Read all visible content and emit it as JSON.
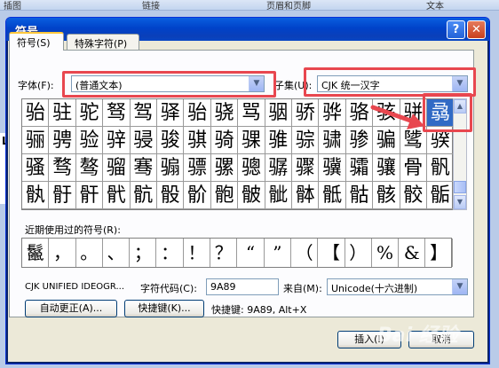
{
  "ribbon": {
    "items": [
      "插图",
      "链接",
      "页眉和页脚",
      "文本"
    ]
  },
  "document": {
    "side_char": "L"
  },
  "dialog": {
    "title": "符号",
    "help_glyph": "?",
    "close_glyph": "✕",
    "tabs": [
      {
        "label": "符号(S)",
        "active": true
      },
      {
        "label": "特殊字符(P)",
        "active": false
      }
    ],
    "font_label": "字体(F):",
    "font_value": "(普通文本)",
    "subset_label": "子集(U):",
    "subset_value": "CJK 统一汉字",
    "symbol_grid": [
      [
        "骀",
        "驻",
        "驼",
        "驽",
        "驾",
        "驿",
        "骀",
        "骁",
        "骂",
        "骃",
        "骄",
        "骅",
        "骆",
        "骇",
        "骈",
        "骉"
      ],
      [
        "骊",
        "骋",
        "验",
        "骍",
        "骎",
        "骏",
        "骐",
        "骑",
        "骒",
        "骓",
        "骔",
        "骕",
        "骖",
        "骗",
        "骘",
        "骙"
      ],
      [
        "骚",
        "骛",
        "骜",
        "骝",
        "骞",
        "骟",
        "骠",
        "骡",
        "骢",
        "骣",
        "骤",
        "骥",
        "骦",
        "骧",
        "骨",
        "骪"
      ],
      [
        "骫",
        "骬",
        "骭",
        "骮",
        "骯",
        "骰",
        "骱",
        "骲",
        "骳",
        "骴",
        "骵",
        "骶",
        "骷",
        "骸",
        "骹",
        "骺"
      ]
    ],
    "selected": {
      "row": 0,
      "col": 15
    },
    "recent_label": "近期使用过的符号(R):",
    "recent_symbols": [
      "鬣",
      "，",
      "。",
      "、",
      "；",
      "：",
      "！",
      "？",
      "“",
      "”",
      "（",
      "【",
      "）",
      "%",
      "&",
      "】"
    ],
    "char_name": "CJK UNIFIED IDEOGR...",
    "char_code_label": "字符代码(C):",
    "char_code_value": "9A89",
    "from_label": "来自(M):",
    "from_value": "Unicode(十六进制)",
    "autocorrect_label": "自动更正(A)...",
    "shortcut_key_label": "快捷键(K)...",
    "shortcut_text": "快捷键: 9A89, Alt+X",
    "insert_label": "插入(I)",
    "cancel_label": "取消"
  },
  "watermark_text": "Bai 经验"
}
